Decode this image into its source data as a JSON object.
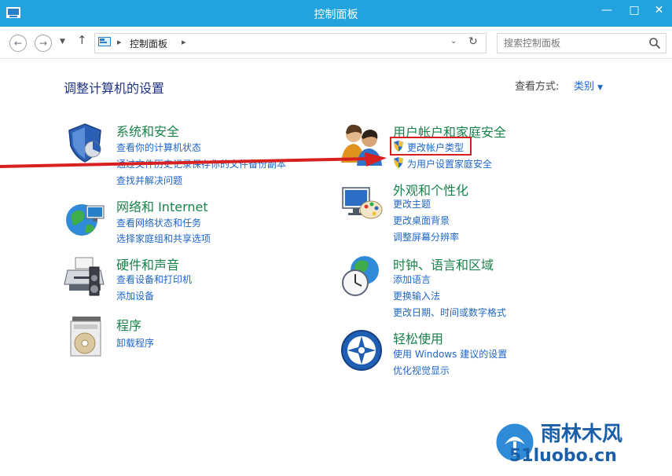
{
  "window": {
    "title": "控制面板"
  },
  "address": {
    "crumb": "控制面板",
    "search_placeholder": "搜索控制面板"
  },
  "header": {
    "heading": "调整计算机的设置",
    "view_by_label": "查看方式:",
    "view_by_value": "类别"
  },
  "left_categories": [
    {
      "title": "系统和安全",
      "icon": "security-shield-icon",
      "links": [
        "查看你的计算机状态",
        "通过文件历史记录保存你的文件备份副本",
        "查找并解决问题"
      ]
    },
    {
      "title": "网络和 Internet",
      "icon": "network-globe-icon",
      "links": [
        "查看网络状态和任务",
        "选择家庭组和共享选项"
      ]
    },
    {
      "title": "硬件和声音",
      "icon": "printer-icon",
      "links": [
        "查看设备和打印机",
        "添加设备"
      ]
    },
    {
      "title": "程序",
      "icon": "programs-disc-icon",
      "links": [
        "卸载程序"
      ]
    }
  ],
  "right_categories": [
    {
      "title": "用户帐户和家庭安全",
      "icon": "users-icon",
      "links": [
        "更改帐户类型",
        "为用户设置家庭安全"
      ]
    },
    {
      "title": "外观和个性化",
      "icon": "monitor-palette-icon",
      "links": [
        "更改主题",
        "更改桌面背景",
        "调整屏幕分辨率"
      ]
    },
    {
      "title": "时钟、语言和区域",
      "icon": "clock-globe-icon",
      "links": [
        "添加语言",
        "更换输入法",
        "更改日期、时间或数字格式"
      ]
    },
    {
      "title": "轻松使用",
      "icon": "ease-of-access-icon",
      "links": [
        "使用 Windows 建议的设置",
        "优化视觉显示"
      ]
    }
  ],
  "watermark": {
    "brand": "雨林木风",
    "site": "51luobo.cn"
  },
  "colors": {
    "titlebar": "#23a3dd",
    "category_title": "#19824a",
    "link": "#1e66c8",
    "highlight": "#d82020"
  }
}
